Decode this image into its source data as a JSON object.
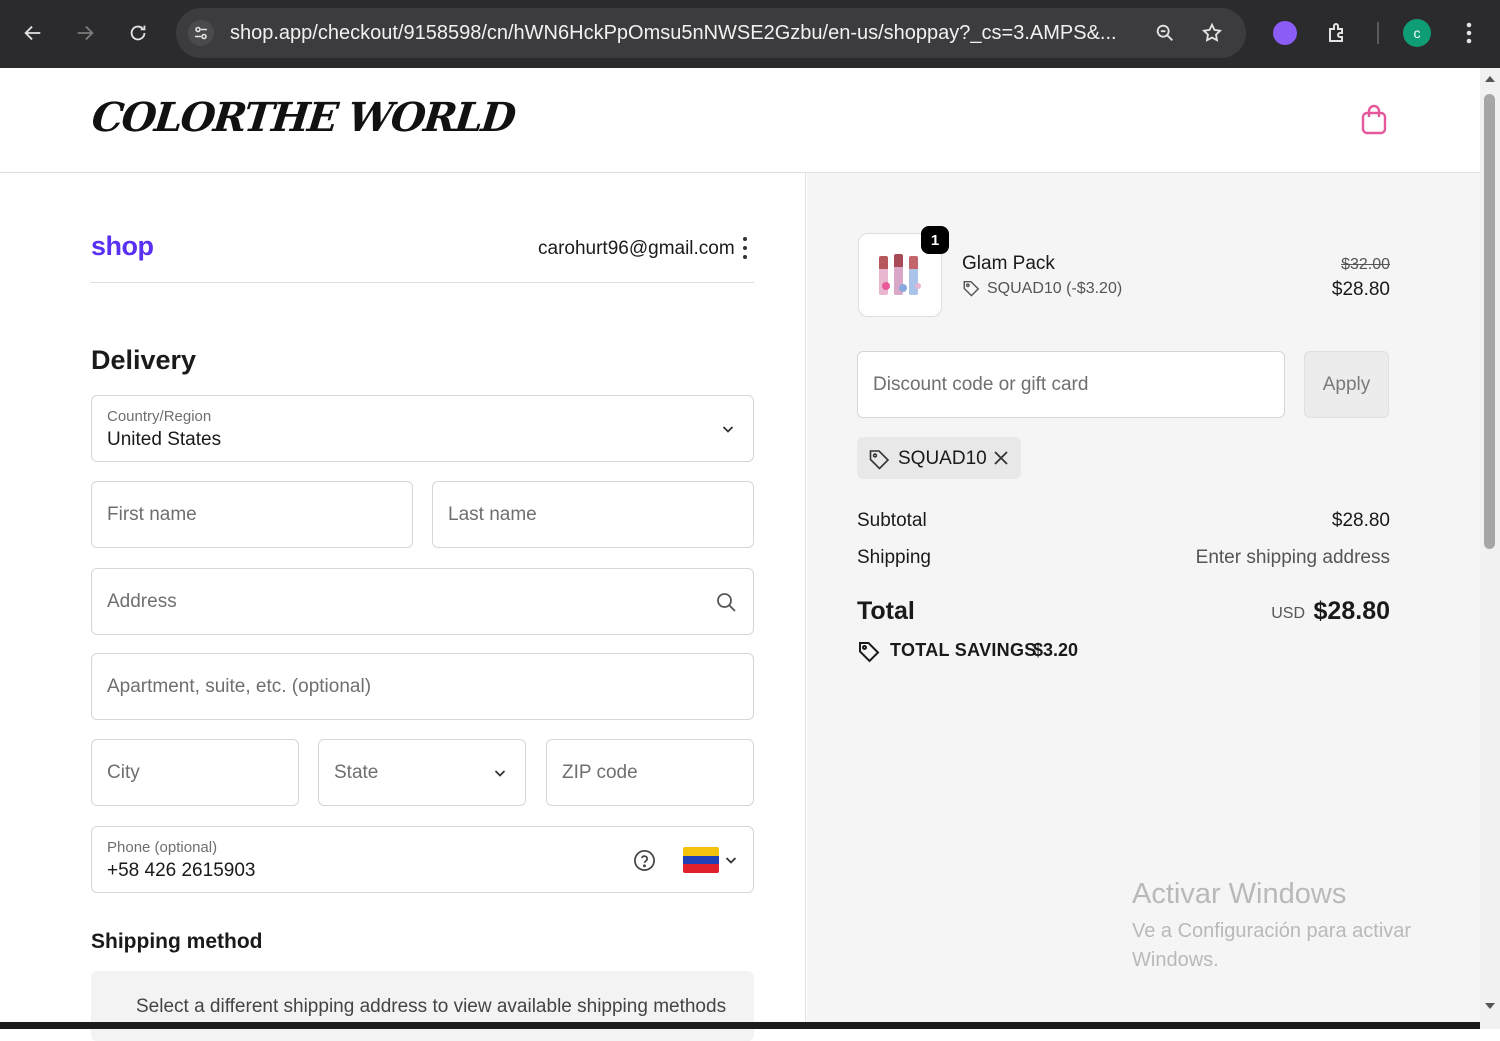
{
  "browser": {
    "url": "shop.app/checkout/9158598/cn/hWN6HckPpOmsu5nNWSE2Gzbu/en-us/shoppay?_cs=3.AMPS&...",
    "profile_initial": "c"
  },
  "header": {
    "brand": "COLORTHE WORLD"
  },
  "shop": {
    "logo": "shop",
    "email": "carohurt96@gmail.com"
  },
  "delivery": {
    "title": "Delivery",
    "country_label": "Country/Region",
    "country_value": "United States",
    "first_name_placeholder": "First name",
    "last_name_placeholder": "Last name",
    "address_placeholder": "Address",
    "apartment_placeholder": "Apartment, suite, etc. (optional)",
    "city_placeholder": "City",
    "state_placeholder": "State",
    "zip_placeholder": "ZIP code",
    "phone_label": "Phone (optional)",
    "phone_value": "+58 426 2615903"
  },
  "shipping_method": {
    "title": "Shipping method",
    "message": "Select a different shipping address to view available shipping methods"
  },
  "order": {
    "quantity": "1",
    "product_name": "Glam Pack",
    "discount_line": "SQUAD10 (-$3.20)",
    "original_price": "$32.00",
    "price": "$28.80",
    "discount_placeholder": "Discount code or gift card",
    "apply_label": "Apply",
    "applied_code": "SQUAD10",
    "subtotal_label": "Subtotal",
    "subtotal_value": "$28.80",
    "shipping_label": "Shipping",
    "shipping_value": "Enter shipping address",
    "total_label": "Total",
    "currency": "USD",
    "total_value": "$28.80",
    "savings_label": "TOTAL SAVINGS",
    "savings_value": "$3.20"
  },
  "watermark": {
    "line1": "Activar Windows",
    "line2": "Ve a Configuración para activar Windows."
  },
  "colors": {
    "shop_purple": "#5a31f4",
    "bag_pink": "#e6579c"
  }
}
